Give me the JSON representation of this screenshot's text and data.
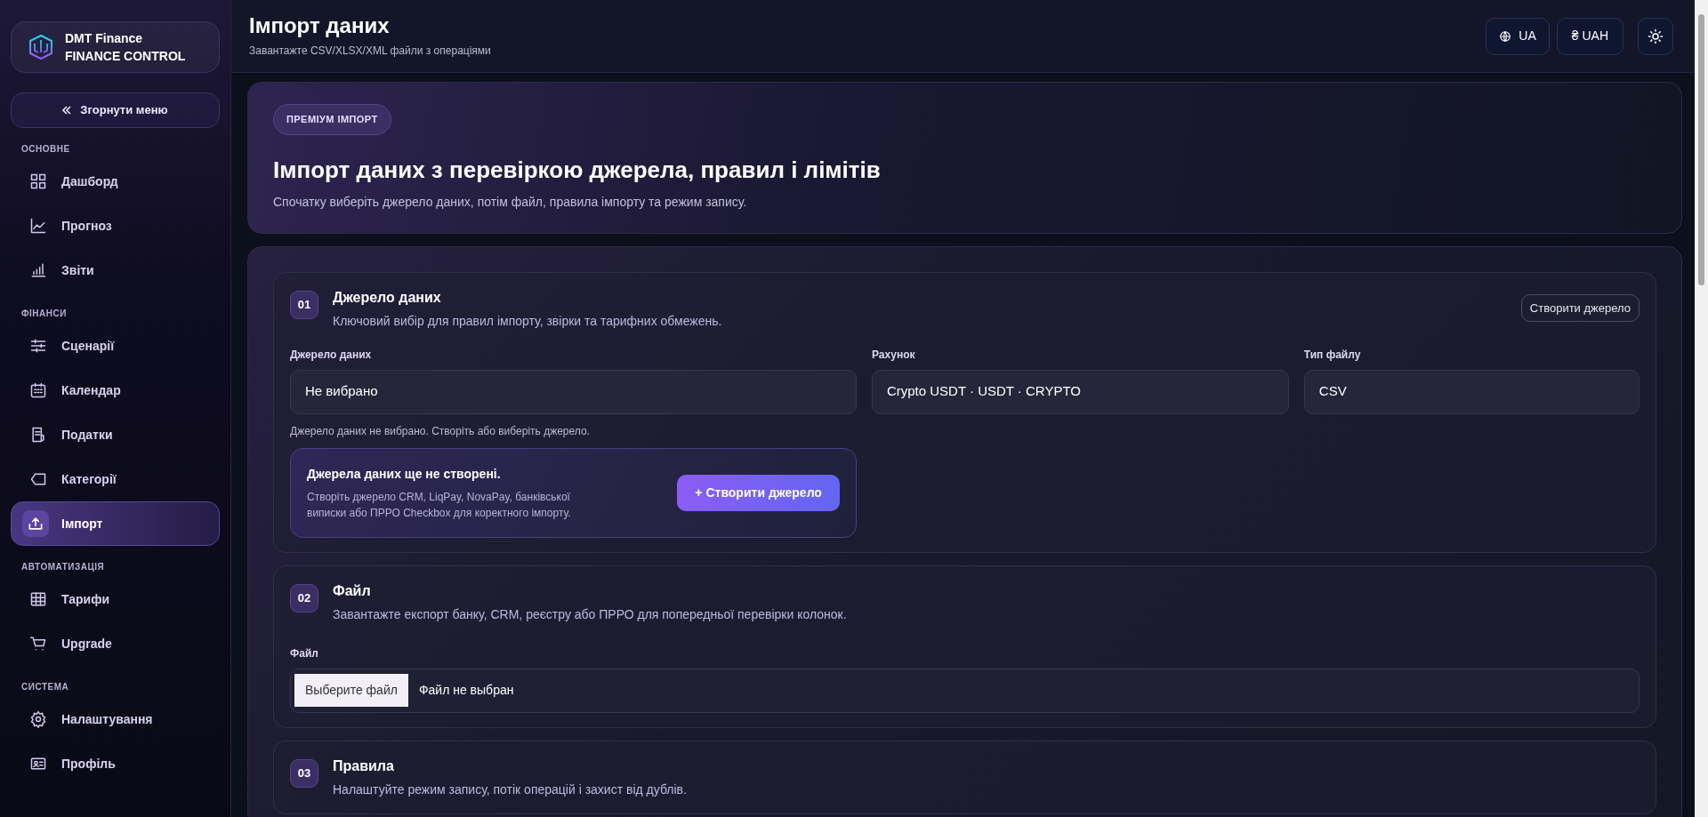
{
  "sidebar": {
    "brand": {
      "name": "DMT Finance",
      "tagline": "FINANCE CONTROL"
    },
    "collapse_button": "Згорнути меню",
    "groups": [
      {
        "title": "ОСНОВНЕ",
        "items": [
          {
            "label": "Дашборд",
            "selected": false
          },
          {
            "label": "Прогноз",
            "selected": false
          },
          {
            "label": "Звіти",
            "selected": false
          }
        ]
      },
      {
        "title": "ФІНАНСИ",
        "items": [
          {
            "label": "Сценарії",
            "selected": false
          },
          {
            "label": "Календар",
            "selected": false
          },
          {
            "label": "Податки",
            "selected": false
          },
          {
            "label": "Категорії",
            "selected": false
          },
          {
            "label": "Імпорт",
            "selected": true
          }
        ]
      },
      {
        "title": "АВТОМАТИЗАЦІЯ",
        "items": [
          {
            "label": "Тарифи",
            "selected": false
          },
          {
            "label": "Upgrade",
            "selected": false
          }
        ]
      },
      {
        "title": "СИСТЕМА",
        "items": [
          {
            "label": "Налаштування",
            "selected": false
          },
          {
            "label": "Профіль",
            "selected": false
          }
        ]
      }
    ]
  },
  "header": {
    "title": "Імпорт даних",
    "subtitle": "Завантажте CSV/XLSX/XML файли з операціями",
    "language_button": "UA",
    "currency_button": "₴ UAH"
  },
  "hero": {
    "badge": "ПРЕМІУМ ІМПОРТ",
    "title": "Імпорт даних з перевіркою джерела, правил і лімітів",
    "subtitle": "Спочатку виберіть джерело даних, потім файл, правила імпорту та режим запису."
  },
  "sections": [
    {
      "number": "01",
      "title": "Джерело даних",
      "subtitle": "Ключовий вибір для правил імпорту, звірки та тарифних обмежень.",
      "action": "Створити джерело",
      "fields": [
        {
          "label": "Джерело даних",
          "value": "Не вибрано"
        },
        {
          "label": "Рахунок",
          "value": "Crypto USDT · USDT · CRYPTO"
        },
        {
          "label": "Тип файлу",
          "value": "CSV"
        }
      ],
      "hint": "Джерело даних не вибрано. Створіть або виберіть джерело.",
      "empty_state": {
        "title": "Джерела даних ще не створені.",
        "text": "Створіть джерело CRM, LiqPay, NovaPay, банківської виписки або ПРРО Checkbox для коректного імпорту.",
        "button": "+ Створити джерело"
      }
    },
    {
      "number": "02",
      "title": "Файл",
      "subtitle": "Завантажте експорт банку, CRM, реєстру або ПРРО для попередньої перевірки колонок.",
      "file_field": {
        "label": "Файл",
        "button": "Выберите файл",
        "status": "Файл не выбран"
      }
    },
    {
      "number": "03",
      "title": "Правила",
      "subtitle": "Налаштуйте режим запису, потік операцій і захист від дублів."
    }
  ]
}
